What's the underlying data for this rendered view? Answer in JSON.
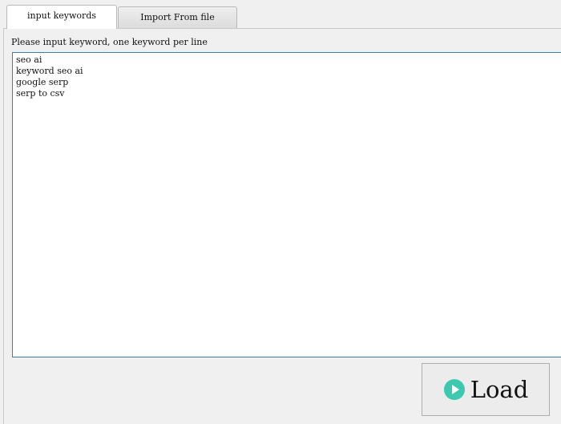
{
  "tabs": [
    {
      "label": "input keywords",
      "active": true
    },
    {
      "label": "Import From file",
      "active": false
    }
  ],
  "panel": {
    "instruction": "Please input keyword, one keyword per line",
    "keywords_value": "seo ai\nkeyword seo ai\ngoogle serp\nserp to csv"
  },
  "load_button": {
    "label": "Load",
    "icon": "play-icon",
    "icon_color": "#3cc9b0"
  }
}
